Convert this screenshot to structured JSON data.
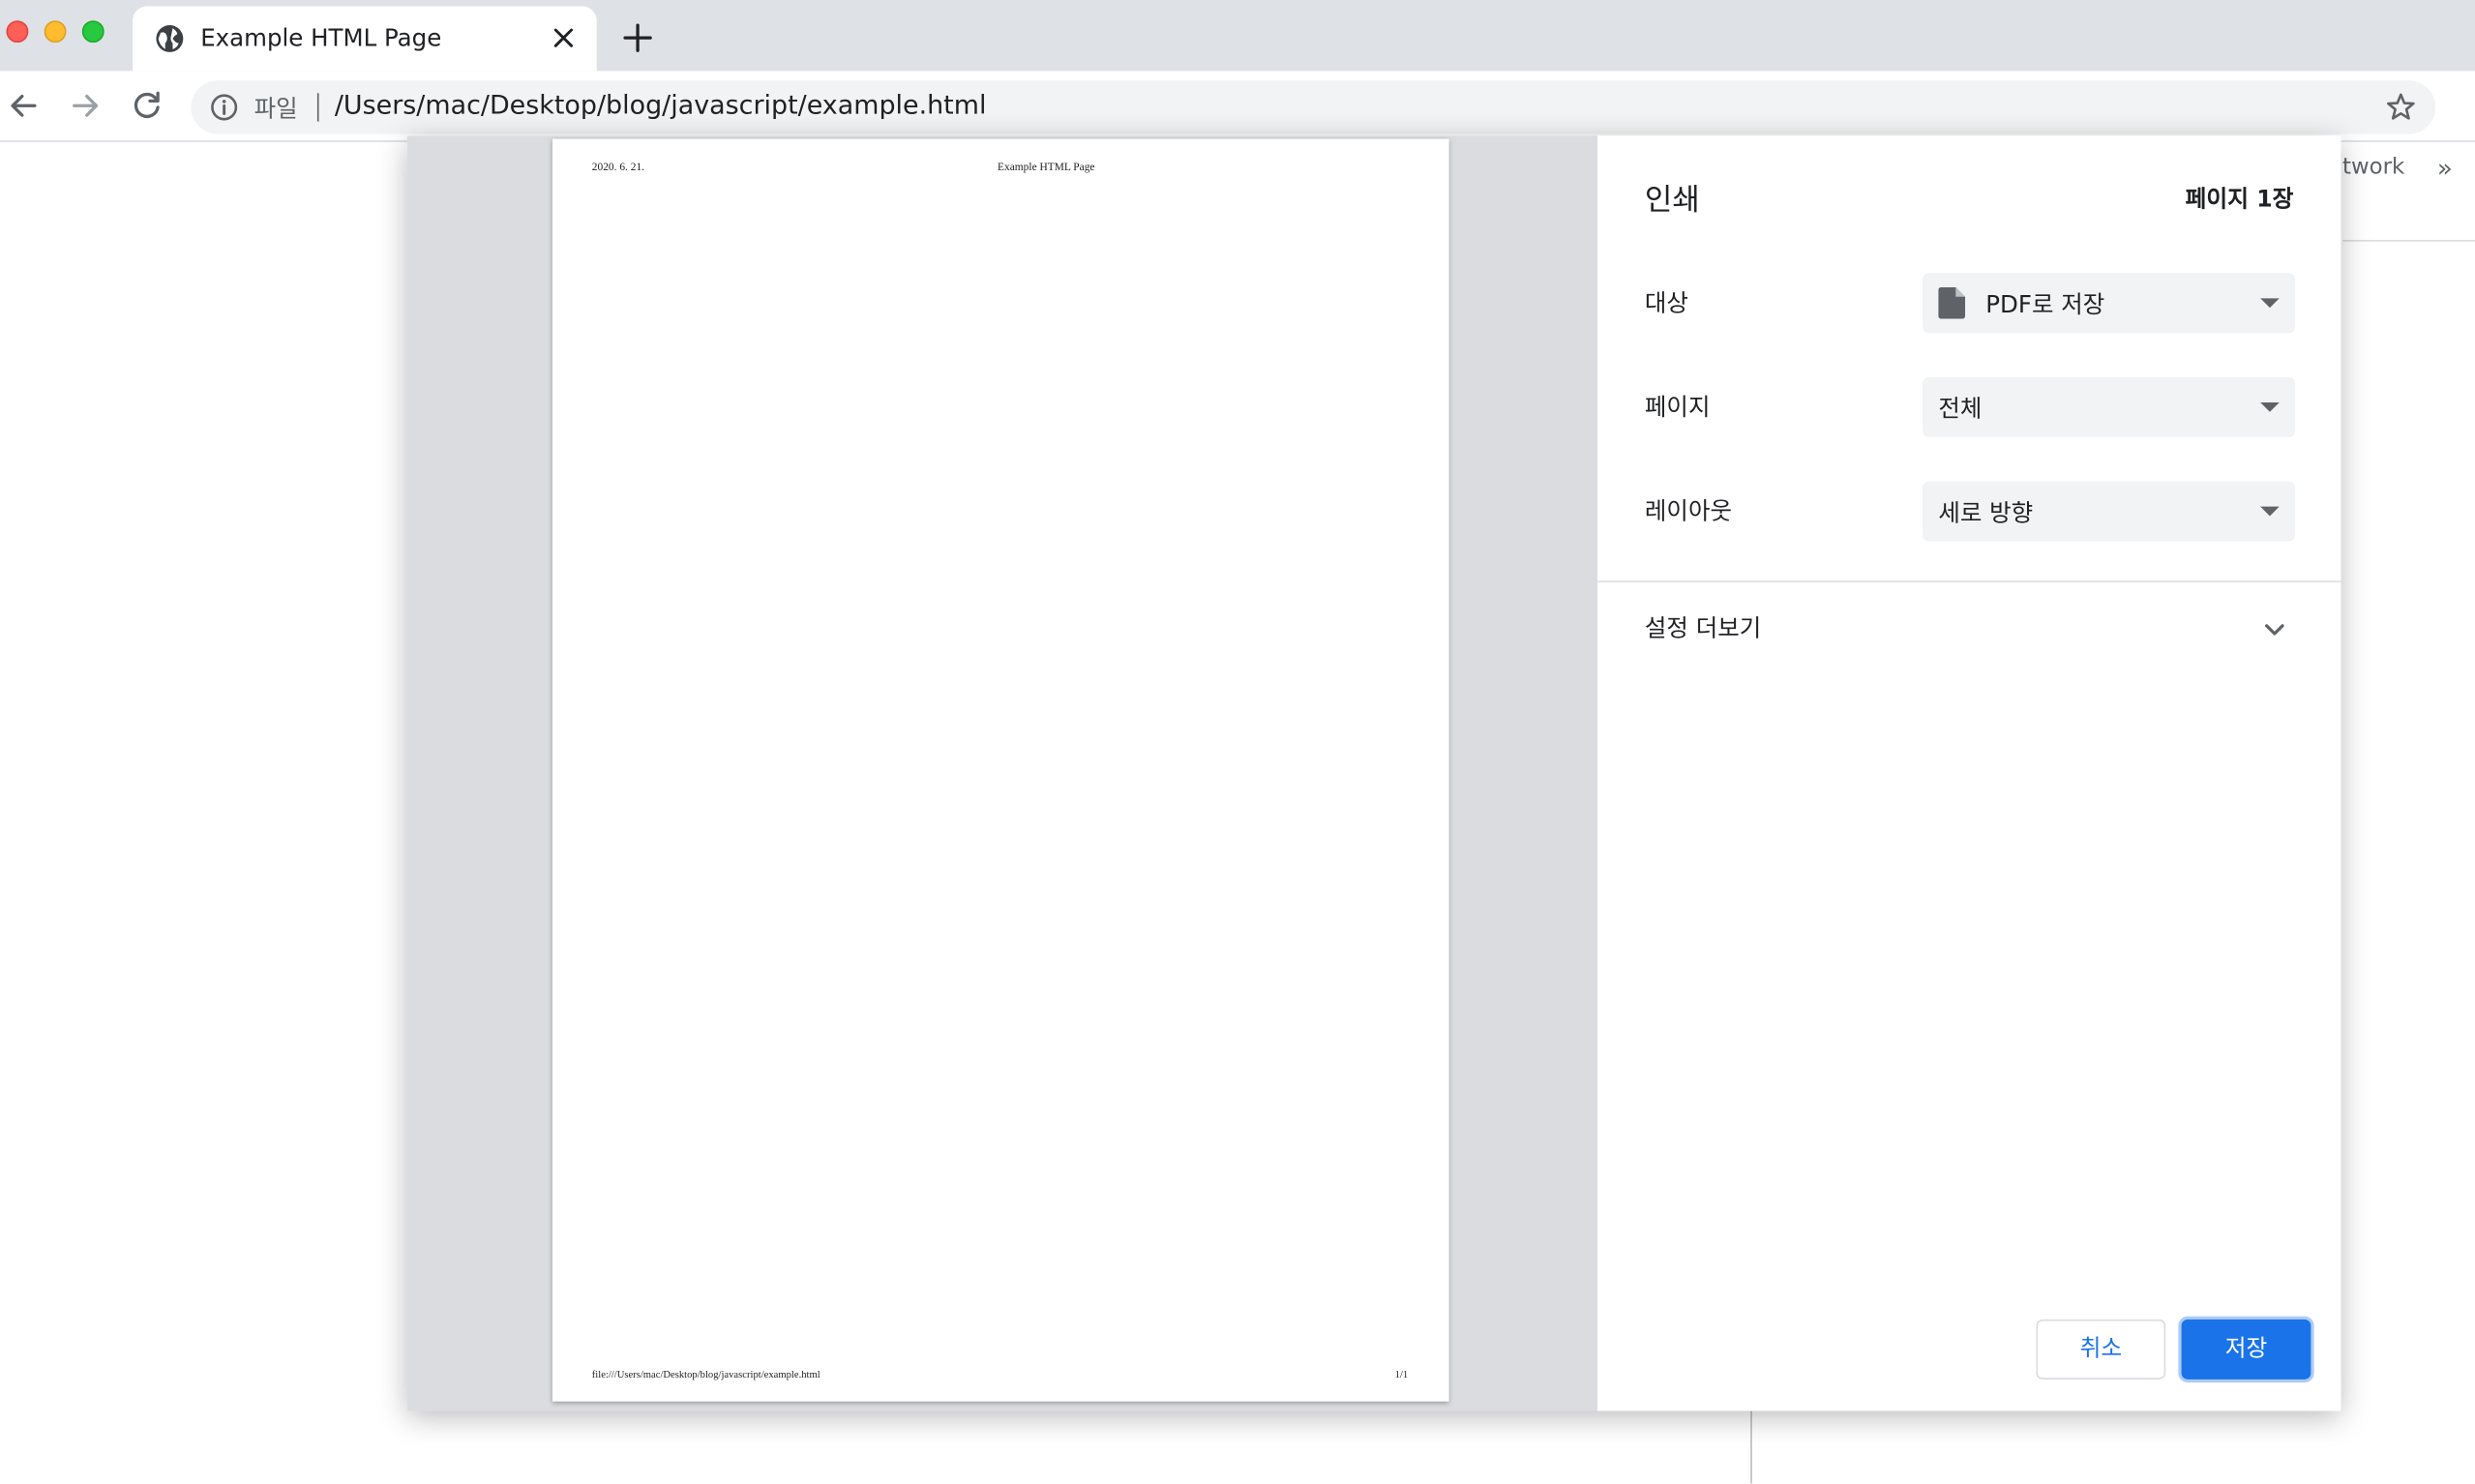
{
  "browser": {
    "tab_title": "Example HTML Page",
    "address": {
      "chip": "파일",
      "url": "/Users/mac/Desktop/blog/javascript/example.html"
    }
  },
  "background_page": {
    "devtools_tab_fragment": "twork",
    "overflow_chevron": "»"
  },
  "preview": {
    "header_date": "2020. 6. 21.",
    "header_title": "Example HTML Page",
    "footer_url": "file:///Users/mac/Desktop/blog/javascript/example.html",
    "footer_page": "1/1"
  },
  "print_dialog": {
    "title": "인쇄",
    "page_count": "페이지 1장",
    "destination": {
      "label": "대상",
      "value": "PDF로 저장"
    },
    "pages": {
      "label": "페이지",
      "value": "전체"
    },
    "layout": {
      "label": "레이아웃",
      "value": "세로 방향"
    },
    "more_settings": "설정 더보기",
    "cancel_label": "취소",
    "save_label": "저장"
  },
  "colors": {
    "accent": "#1a73e8",
    "tabstrip": "#dee1e6",
    "preview_bg": "#dadce0"
  },
  "icons": [
    "globe-icon",
    "close-icon",
    "plus-icon",
    "back-icon",
    "forward-icon",
    "reload-icon",
    "info-icon",
    "star-icon",
    "document-icon",
    "dropdown-arrow-icon",
    "chevron-down-icon"
  ]
}
